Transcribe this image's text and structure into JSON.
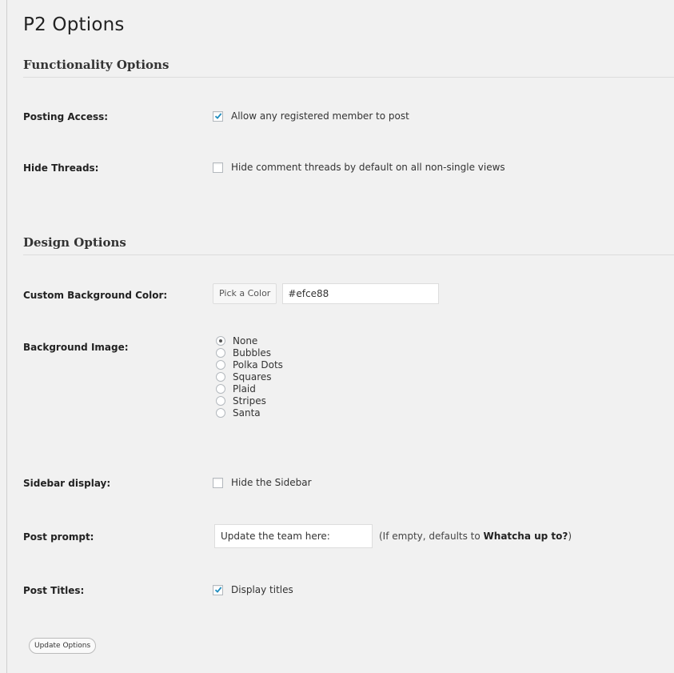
{
  "page": {
    "title": "P2 Options"
  },
  "functionality": {
    "heading": "Functionality Options",
    "posting_access": {
      "label": "Posting Access:",
      "text": "Allow any registered member to post",
      "checked": true
    },
    "hide_threads": {
      "label": "Hide Threads:",
      "text": "Hide comment threads by default on all non-single views",
      "checked": false
    }
  },
  "design": {
    "heading": "Design Options",
    "bg_color": {
      "label": "Custom Background Color:",
      "button": "Pick a Color",
      "value": "#efce88"
    },
    "bg_image": {
      "label": "Background Image:",
      "options": [
        "None",
        "Bubbles",
        "Polka Dots",
        "Squares",
        "Plaid",
        "Stripes",
        "Santa"
      ],
      "selected": "None"
    },
    "sidebar": {
      "label": "Sidebar display:",
      "text": "Hide the Sidebar",
      "checked": false
    },
    "post_prompt": {
      "label": "Post prompt:",
      "value": "Update the team here:",
      "hint_prefix": "(If empty, defaults to ",
      "hint_bold": "Whatcha up to?",
      "hint_suffix": ")"
    },
    "post_titles": {
      "label": "Post Titles:",
      "text": "Display titles",
      "checked": true
    }
  },
  "actions": {
    "update": "Update Options"
  },
  "icons": {
    "checkmark": "checkmark-icon",
    "radio_dot": "radio-dot-icon"
  }
}
